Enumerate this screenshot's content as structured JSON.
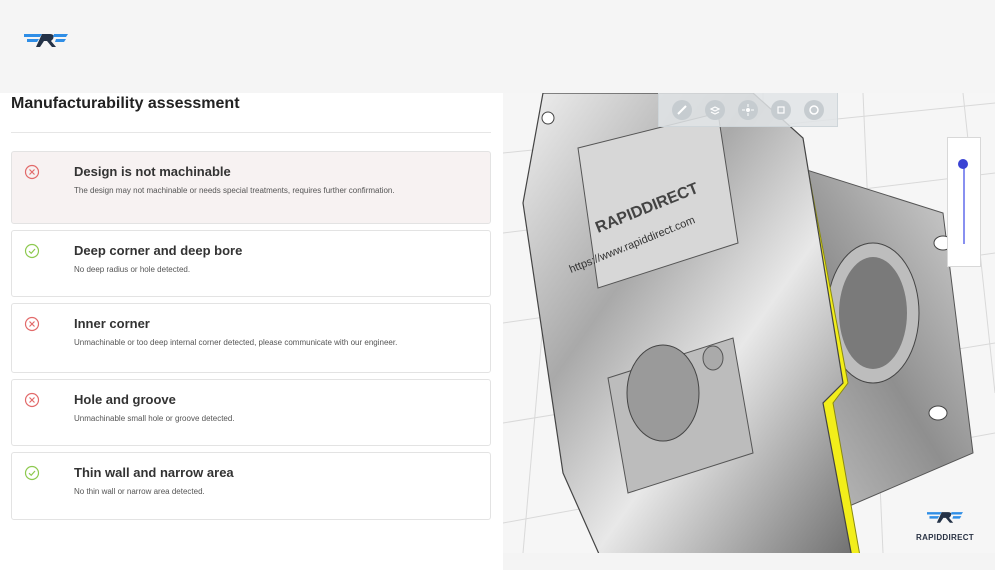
{
  "header": {
    "logo_icon": "rapiddirect-logo-icon"
  },
  "assessment": {
    "title": "Manufacturability assessment",
    "items": [
      {
        "status": "fail",
        "icon": "x-circle-icon",
        "title": "Design is not machinable",
        "description": "The design may not machinable or needs special treatments, requires further confirmation."
      },
      {
        "status": "pass",
        "icon": "check-circle-icon",
        "title": "Deep corner and deep bore",
        "description": "No deep radius or hole detected."
      },
      {
        "status": "fail",
        "icon": "x-circle-icon",
        "title": "Inner corner",
        "description": "Unmachinable or too deep internal corner detected, please communicate with our engineer."
      },
      {
        "status": "fail",
        "icon": "x-circle-icon",
        "title": "Hole and groove",
        "description": "Unmachinable small hole or groove detected."
      },
      {
        "status": "pass",
        "icon": "check-circle-icon",
        "title": "Thin wall and narrow area",
        "description": "No thin wall or narrow area detected."
      }
    ]
  },
  "viewer": {
    "toolbar": [
      "measure-icon",
      "layers-icon",
      "explode-icon",
      "cube-icon",
      "reset-icon"
    ],
    "part_label": "RAPIDDIRECT",
    "part_url": "https://www.rapiddirect.com",
    "watermark": "RAPIDDIRECT",
    "slider_level": 1.0
  },
  "colors": {
    "fail": "#e26a6a",
    "pass": "#8dc94f",
    "highlight": "#f2ee1a",
    "brand_blue": "#2f8ee6"
  }
}
